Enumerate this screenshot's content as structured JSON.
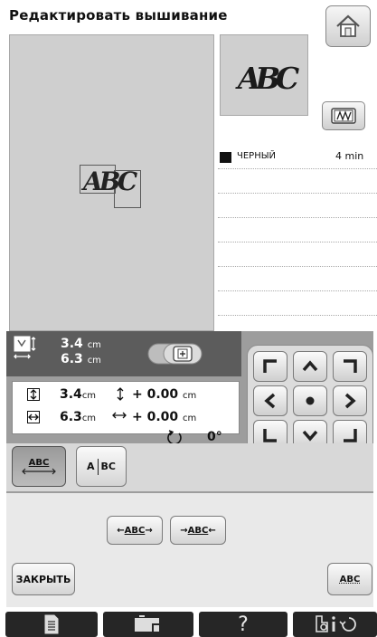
{
  "header": {
    "title": "Редактировать вышивание"
  },
  "icons": {
    "home": "house-icon",
    "preview": "hoop-stitch-icon",
    "size": "size-arrows-icon",
    "frame": "frame-toggle-icon",
    "page": "page-icon",
    "machine": "machine-icon",
    "help": "question-icon",
    "settings": "settings-info-icon"
  },
  "canvas": {
    "design_text": "ABC"
  },
  "preview": {
    "design_text": "ABC"
  },
  "thread_list": {
    "items": [
      {
        "color_name": "ЧЕРНЫЙ",
        "time": "4 min",
        "swatch": "#111111"
      }
    ]
  },
  "size_info": {
    "height": "3.4",
    "width": "6.3",
    "unit": "cm"
  },
  "info_box": {
    "height": "3.4",
    "width": "6.3",
    "unit": "cm",
    "offset_vertical": "+ 0.00",
    "offset_horizontal": "+ 0.00",
    "rotation": "0°"
  },
  "layout": {
    "button1": "ABC",
    "button2": "A",
    "button2b": "BC"
  },
  "arrange": {
    "spacing_wider": "ABC",
    "spacing_narrower": "ABC"
  },
  "footer": {
    "close_label": "ЗАКРЫТЬ",
    "text_button": "ABC",
    "help": "?"
  },
  "colors": {
    "panel_dark": "#5c5c5c",
    "panel": "#9d9d9d",
    "canvas": "#cfcfcf"
  }
}
